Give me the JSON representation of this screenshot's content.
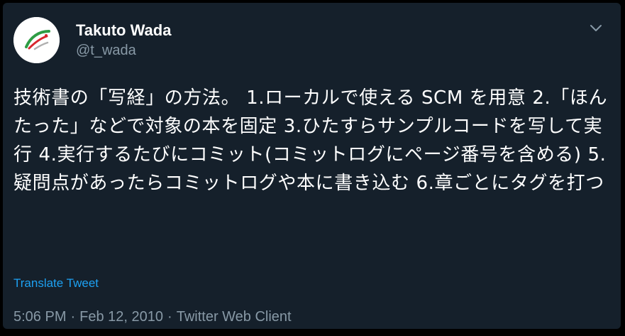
{
  "tweet": {
    "author": {
      "display_name": "Takuto Wada",
      "handle": "@t_wada",
      "avatar_icon": "swoosh-logo-icon"
    },
    "menu_icon": "chevron-down-icon",
    "text": "技術書の「写経」の方法。 1.ローカルで使える SCM を用意 2.「ほんたった」などで対象の本を固定 3.ひたすらサンプルコードを写して実行 4.実行するたびにコミット(コミットログにページ番号を含める) 5.疑問点があったらコミットログや本に書き込む 6.章ごとにタグを打つ",
    "translate_label": "Translate Tweet",
    "meta": {
      "time": "5:06 PM",
      "separator": "·",
      "date": "Feb 12, 2010",
      "client": "Twitter Web Client"
    }
  },
  "colors": {
    "background": "#15202b",
    "primary_text": "#ffffff",
    "secondary_text": "#8899a6",
    "link": "#1da1f2"
  }
}
